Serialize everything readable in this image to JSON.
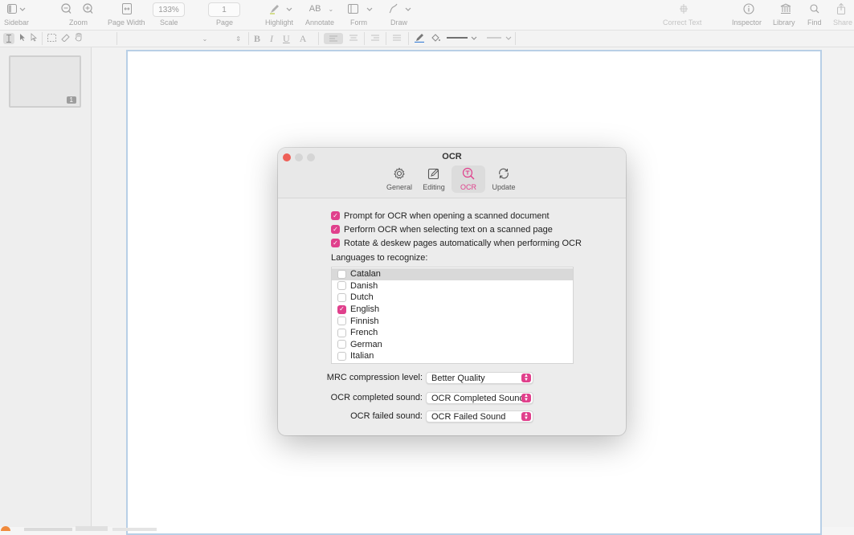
{
  "toolbar": {
    "items": [
      {
        "label": "Sidebar",
        "icon": "sidebar-icon"
      },
      {
        "label": "Zoom",
        "icon": "zoom-icon"
      },
      {
        "label": "Page Width",
        "icon": "page-width-icon"
      },
      {
        "label": "Scale",
        "value": "133%"
      },
      {
        "label": "Page",
        "value": "1"
      },
      {
        "label": "Highlight",
        "icon": "highlighter-icon"
      },
      {
        "label": "Annotate",
        "icon": "annotate-icon",
        "glyph": "AB"
      },
      {
        "label": "Form",
        "icon": "form-icon"
      },
      {
        "label": "Draw",
        "icon": "draw-icon"
      },
      {
        "label": "Correct Text",
        "icon": "correct-text-icon"
      },
      {
        "label": "Inspector",
        "icon": "info-icon"
      },
      {
        "label": "Library",
        "icon": "library-icon"
      },
      {
        "label": "Find",
        "icon": "search-icon"
      },
      {
        "label": "Share",
        "icon": "share-icon"
      }
    ]
  },
  "formatbar": {
    "bold": "B",
    "italic": "I",
    "underline": "U",
    "font_color": "A"
  },
  "sidebar": {
    "thumbnail_page": "1"
  },
  "dialog": {
    "title": "OCR",
    "tabs": [
      {
        "label": "General",
        "icon": "gear-icon",
        "active": false
      },
      {
        "label": "Editing",
        "icon": "pencil-square-icon",
        "active": false
      },
      {
        "label": "OCR",
        "icon": "text-magnifier-icon",
        "active": true
      },
      {
        "label": "Update",
        "icon": "refresh-icon",
        "active": false
      }
    ],
    "options": [
      {
        "label": "Prompt for OCR when opening a scanned document",
        "checked": true
      },
      {
        "label": "Perform OCR when selecting text on a scanned page",
        "checked": true
      },
      {
        "label": "Rotate & deskew pages automatically when performing OCR",
        "checked": true
      }
    ],
    "languages_label": "Languages to recognize:",
    "languages": [
      {
        "name": "Catalan",
        "checked": false,
        "selected": true
      },
      {
        "name": "Danish",
        "checked": false,
        "selected": false
      },
      {
        "name": "Dutch",
        "checked": false,
        "selected": false
      },
      {
        "name": "English",
        "checked": true,
        "selected": false
      },
      {
        "name": "Finnish",
        "checked": false,
        "selected": false
      },
      {
        "name": "French",
        "checked": false,
        "selected": false
      },
      {
        "name": "German",
        "checked": false,
        "selected": false
      },
      {
        "name": "Italian",
        "checked": false,
        "selected": false
      }
    ],
    "mrc_label": "MRC compression level:",
    "mrc_value": "Better Quality",
    "completed_label": "OCR completed sound:",
    "completed_value": "OCR Completed Sound",
    "failed_label": "OCR failed sound:",
    "failed_value": "OCR Failed Sound"
  },
  "colors": {
    "accent": "#e0408c",
    "close": "#ee5f57",
    "page_border": "#b8cfe6"
  }
}
